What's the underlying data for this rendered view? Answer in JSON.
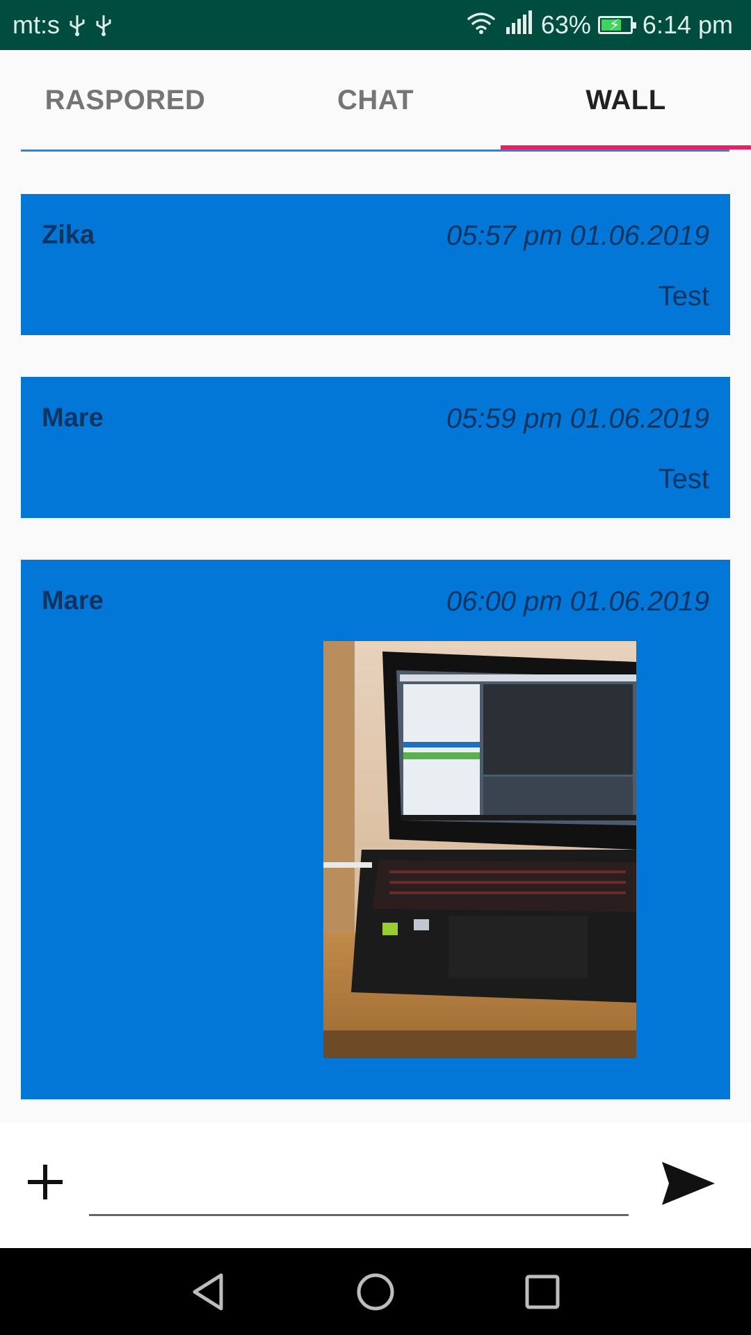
{
  "status_bar": {
    "carrier": "mt:s",
    "battery_percent": "63%",
    "time": "6:14 pm",
    "icons": [
      "usb-icon",
      "usb-icon",
      "wifi-icon",
      "signal-icon",
      "battery-charging-icon"
    ],
    "background_color": "#004d40"
  },
  "tabs": [
    {
      "label": "RASPORED",
      "selected": false
    },
    {
      "label": "CHAT",
      "selected": false
    },
    {
      "label": "WALL",
      "selected": true
    }
  ],
  "accent": {
    "tab_indicator": "#e91e63",
    "post_background": "#0277d8"
  },
  "posts": [
    {
      "author": "Zika",
      "timestamp": "05:57 pm 01.06.2019",
      "text": "Test"
    },
    {
      "author": "Mare",
      "timestamp": "05:59 pm 01.06.2019",
      "text": "Test"
    },
    {
      "author": "Mare",
      "timestamp": "06:00 pm 01.06.2019",
      "text": "",
      "has_image": true
    }
  ],
  "composer": {
    "input_value": "",
    "placeholder": "",
    "add_icon": "plus-icon",
    "send_icon": "send-icon"
  },
  "nav_bar": {
    "icons": [
      "back-icon",
      "home-icon",
      "recents-icon"
    ]
  }
}
